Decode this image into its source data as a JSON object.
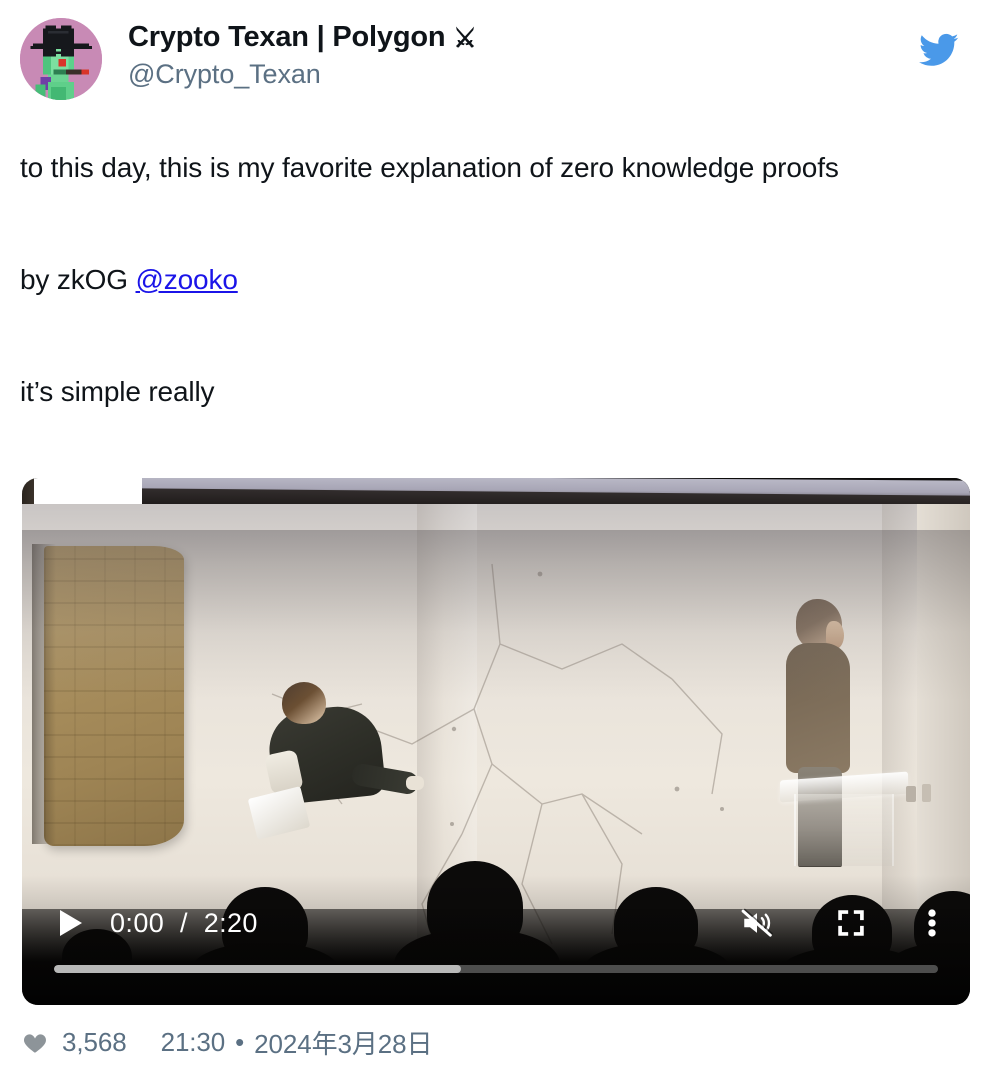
{
  "author": {
    "display_name": "Crypto Texan | Polygon",
    "display_name_emoji": "⚔",
    "handle": "@Crypto_Texan",
    "avatar_alt": "pixel-art-avatar"
  },
  "brand": {
    "logo_name": "twitter-bird-logo",
    "logo_color": "#4a99e9",
    "link_color": "#1b14e8",
    "muted_text_color": "#5b7083",
    "text_color": "#0f1419"
  },
  "tweet": {
    "text_part1": "to this day, this is my favorite explanation of zero knowledge proofs",
    "text_blank1": "",
    "text_part2_prefix": "by zkOG ",
    "mention": "@zooko",
    "text_blank2": "",
    "text_part3": "it’s simple really"
  },
  "video": {
    "current_time": "0:00",
    "separator": "/",
    "duration": "2:20",
    "progress_percent": 46,
    "play_icon": "play-icon",
    "mute_icon": "volume-muted-icon",
    "fullscreen_icon": "fullscreen-icon",
    "more_icon": "more-options-icon",
    "scene_description": "lecture-hall-video-thumbnail"
  },
  "footer": {
    "like_icon": "heart-icon",
    "like_count": "3,568",
    "time": "21:30",
    "dot": "•",
    "date": "2024年3月28日"
  }
}
